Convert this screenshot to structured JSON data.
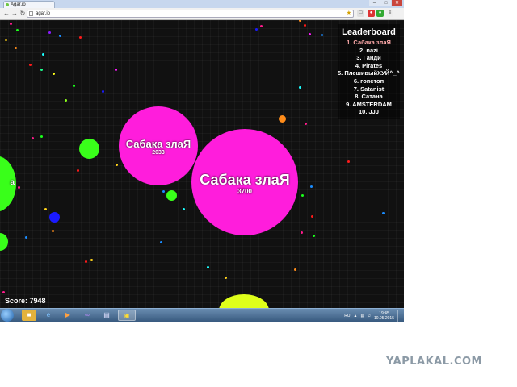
{
  "browser": {
    "tab_title": "Agar.io",
    "url": "agar.io",
    "back_icon": "back-arrow-icon",
    "forward_icon": "forward-arrow-icon",
    "reload_icon": "reload-icon",
    "window_controls": [
      "–",
      "□",
      "✕"
    ]
  },
  "game": {
    "leaderboard_title": "Leaderboard",
    "leaderboard": [
      "1. Сабака злаЯ",
      "2. nazi",
      "3. Ганди",
      "4. Pirates",
      "5. ПлешивыйХУЙ^_^",
      "6. гопстоп",
      "7. Satanist",
      "8. Сатана",
      "9. AMSTERDAM",
      "10. JJJ"
    ],
    "player_cells": [
      {
        "name": "Сабака злаЯ",
        "mass": "3700"
      },
      {
        "name": "Сабака злаЯ",
        "mass": "2033"
      }
    ],
    "score_text": "Score: 7948",
    "colors": {
      "player": "#ff1ddc",
      "green_cell": "#39ff1a",
      "yellow_cell": "#dfff1a",
      "orange_cell": "#ff8c1a",
      "blue_cell": "#1a1aff",
      "background": "#111111"
    }
  },
  "taskbar": {
    "start_icon": "windows-start-icon",
    "apps": [
      "explorer-folder-icon",
      "internet-explorer-icon",
      "media-player-icon",
      "visual-studio-icon",
      "notepad-icon",
      "chrome-icon"
    ],
    "language": "RU",
    "time": "19:45",
    "date": "10.05.2015"
  },
  "watermark": "YAPLAKAL.COM"
}
